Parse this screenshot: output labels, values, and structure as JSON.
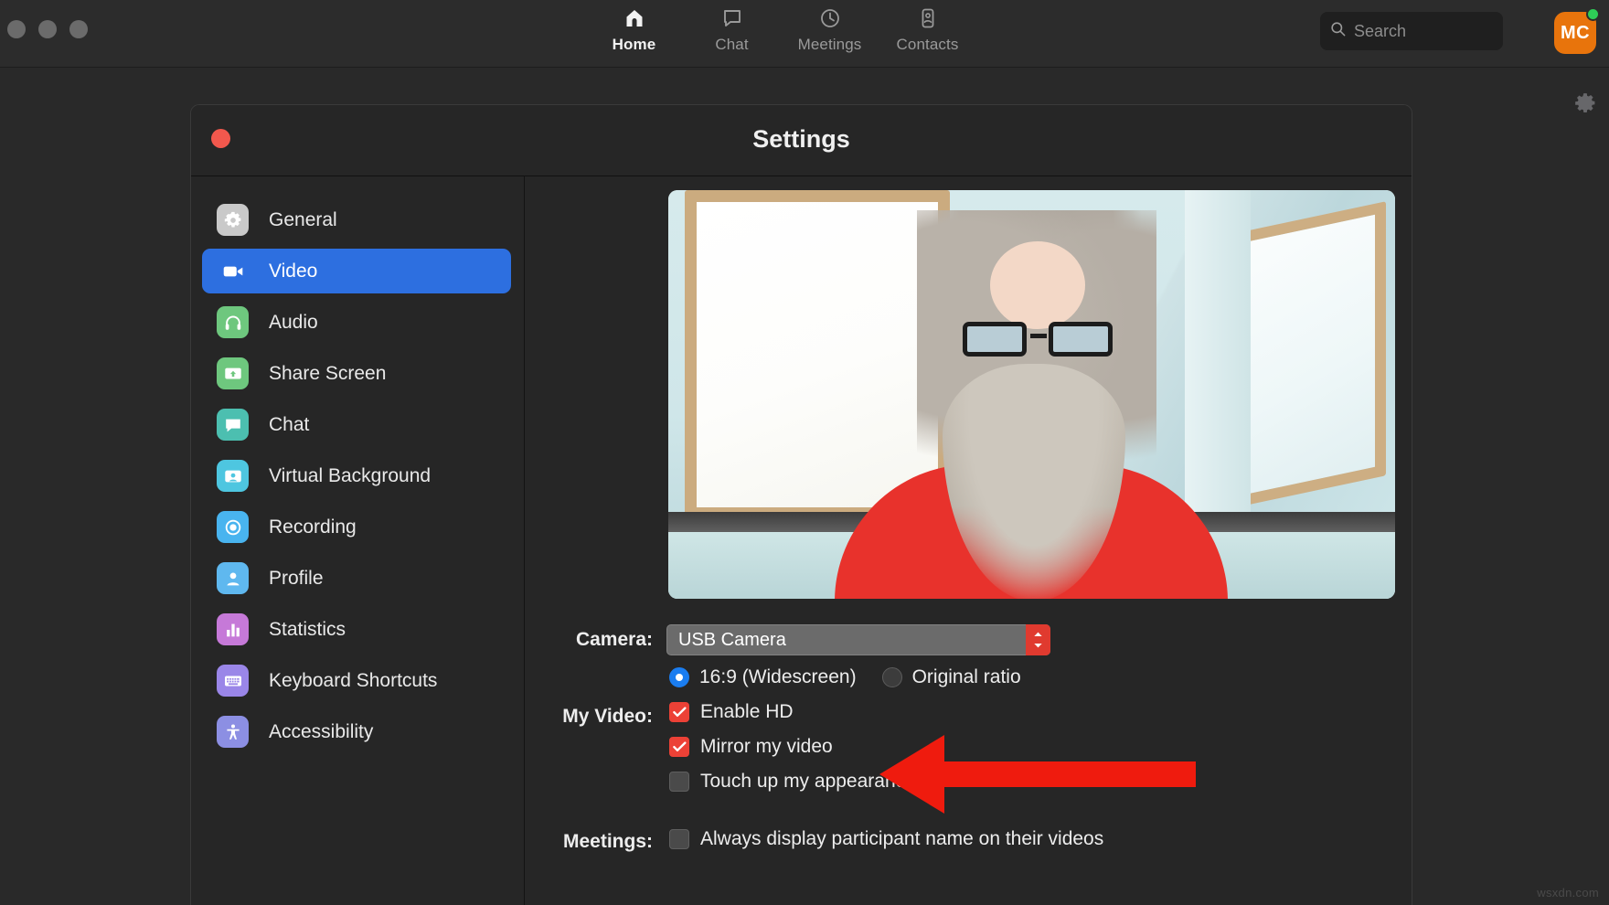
{
  "app": {
    "window_controls": [
      "close",
      "minimize",
      "maximize"
    ],
    "gear_icon": "gear-icon"
  },
  "nav": {
    "tabs": [
      {
        "label": "Home",
        "icon": "home-icon",
        "active": true
      },
      {
        "label": "Chat",
        "icon": "chat-bubble-icon",
        "active": false
      },
      {
        "label": "Meetings",
        "icon": "clock-icon",
        "active": false
      },
      {
        "label": "Contacts",
        "icon": "contact-card-icon",
        "active": false
      }
    ]
  },
  "search": {
    "placeholder": "Search",
    "icon": "search-icon"
  },
  "account": {
    "initials": "MC",
    "avatar_color": "#e8740c",
    "presence": "available",
    "presence_color": "#2ecc57"
  },
  "settings": {
    "title": "Settings",
    "close_color": "#f2584d",
    "sidebar": [
      {
        "label": "General",
        "icon": "gear-icon",
        "color": "#c9c9c9",
        "selected": false
      },
      {
        "label": "Video",
        "icon": "video-camera-icon",
        "color": "#2d6fe0",
        "selected": true
      },
      {
        "label": "Audio",
        "icon": "headphones-icon",
        "color": "#6ec77e",
        "selected": false
      },
      {
        "label": "Share Screen",
        "icon": "share-screen-icon",
        "color": "#6ec77e",
        "selected": false
      },
      {
        "label": "Chat",
        "icon": "chat-bubble-icon",
        "color": "#4cbfb0",
        "selected": false
      },
      {
        "label": "Virtual Background",
        "icon": "virtual-background-icon",
        "color": "#4ec6e0",
        "selected": false
      },
      {
        "label": "Recording",
        "icon": "record-icon",
        "color": "#49b4ef",
        "selected": false
      },
      {
        "label": "Profile",
        "icon": "person-icon",
        "color": "#5fb8ef",
        "selected": false
      },
      {
        "label": "Statistics",
        "icon": "bar-chart-icon",
        "color": "#c679d8",
        "selected": false
      },
      {
        "label": "Keyboard Shortcuts",
        "icon": "keyboard-icon",
        "color": "#9a86e8",
        "selected": false
      },
      {
        "label": "Accessibility",
        "icon": "accessibility-icon",
        "color": "#8c8fe3",
        "selected": false
      }
    ],
    "video": {
      "camera_label": "Camera:",
      "camera_value": "USB Camera",
      "camera_options": [
        "USB Camera"
      ],
      "ratio_options": [
        {
          "label": "16:9 (Widescreen)",
          "selected": true
        },
        {
          "label": "Original ratio",
          "selected": false
        }
      ],
      "my_video_label": "My Video:",
      "my_video_options": [
        {
          "label": "Enable HD",
          "checked": true
        },
        {
          "label": "Mirror my video",
          "checked": true
        },
        {
          "label": "Touch up my appearance",
          "checked": false
        }
      ],
      "meetings_label": "Meetings:",
      "meetings_options": [
        {
          "label": "Always display participant name on their videos",
          "checked": false
        }
      ],
      "checkbox_color": "#ec4136",
      "radio_color": "#1a7df0"
    }
  },
  "annotation": {
    "arrow_color": "#ef1b0e",
    "points_at": "Enable HD"
  },
  "watermark": "wsxdn.com"
}
